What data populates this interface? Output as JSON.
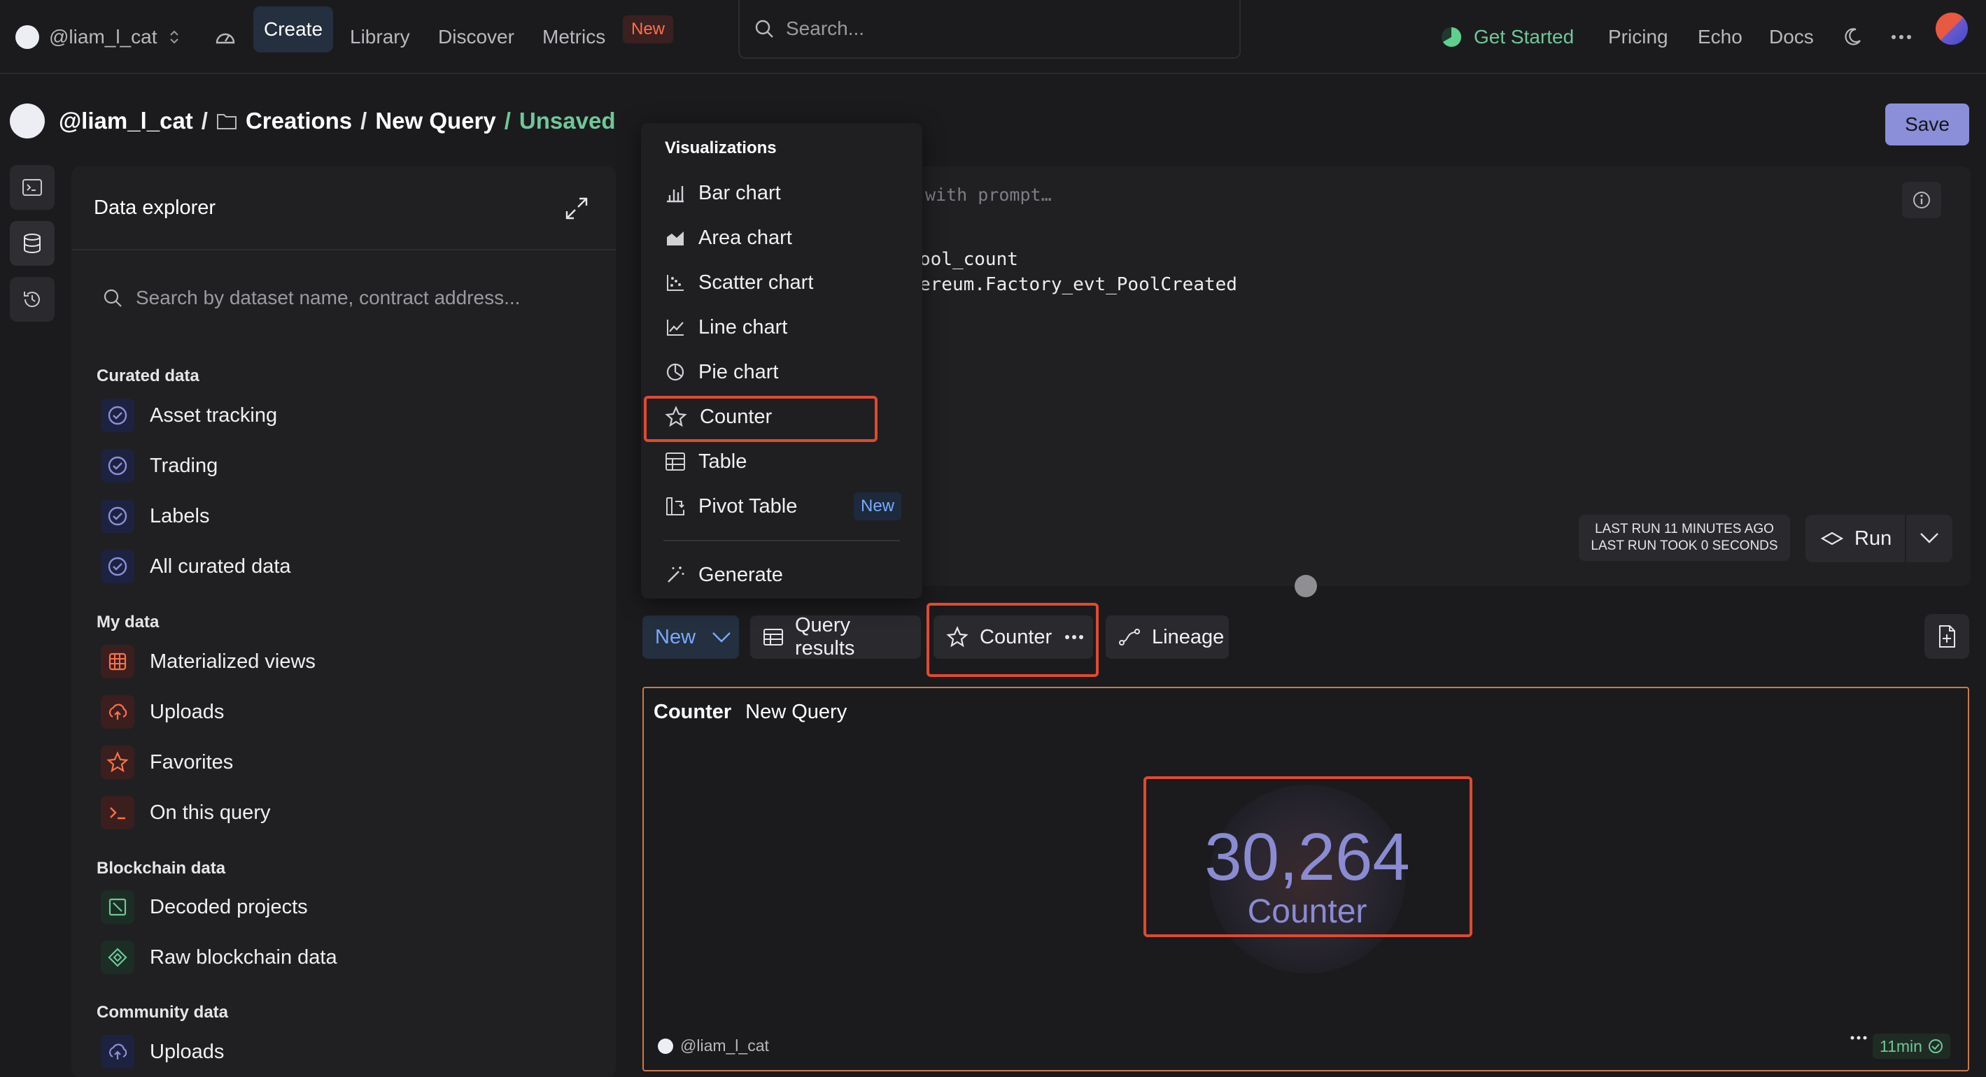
{
  "topnav": {
    "username": "@liam_l_cat",
    "links": [
      "Create",
      "Library",
      "Discover",
      "Metrics"
    ],
    "metrics_badge": "New",
    "search_placeholder": "Search...",
    "get_started": "Get Started",
    "right_links": [
      "Pricing",
      "Echo",
      "Docs"
    ]
  },
  "breadcrumb": {
    "owner": "@liam_l_cat",
    "sep": "/",
    "folder": "Creations",
    "query": "New Query",
    "status": "Unsaved"
  },
  "save_label": "Save",
  "explorer": {
    "title": "Data explorer",
    "search_placeholder": "Search by dataset name, contract address...",
    "sections": [
      {
        "title": "Curated data",
        "items": [
          "Asset tracking",
          "Trading",
          "Labels",
          "All curated data"
        ]
      },
      {
        "title": "My data",
        "items": [
          "Materialized views",
          "Uploads",
          "Favorites",
          "On this query"
        ]
      },
      {
        "title": "Blockchain data",
        "items": [
          "Decoded projects",
          "Raw blockchain data"
        ]
      },
      {
        "title": "Community data",
        "items": [
          "Uploads"
        ]
      }
    ]
  },
  "editor": {
    "prompt_hint": "with prompt…",
    "code_lines": [
      "ool_count",
      "ereum.Factory_evt_PoolCreated"
    ],
    "last_run_line1": "LAST RUN 11 MINUTES AGO",
    "last_run_line2": "LAST RUN TOOK 0 SECONDS",
    "run_label": "Run"
  },
  "dropdown": {
    "heading": "Visualizations",
    "items": [
      "Bar chart",
      "Area chart",
      "Scatter chart",
      "Line chart",
      "Pie chart",
      "Counter",
      "Table",
      "Pivot Table"
    ],
    "pivot_badge": "New",
    "generate": "Generate",
    "highlighted": "Counter"
  },
  "tabs": {
    "new_label": "New",
    "results_label": "Query results",
    "counter_label": "Counter",
    "lineage_label": "Lineage"
  },
  "visualization": {
    "type_label": "Counter",
    "query_name": "New Query",
    "value": "30,264",
    "label": "Counter",
    "owner": "@liam_l_cat",
    "age": "11min"
  },
  "colors": {
    "accent": "#8b8fd9",
    "unsaved": "#6fc79a",
    "highlight": "#e04a2f",
    "new_badge": "#ff7048"
  }
}
